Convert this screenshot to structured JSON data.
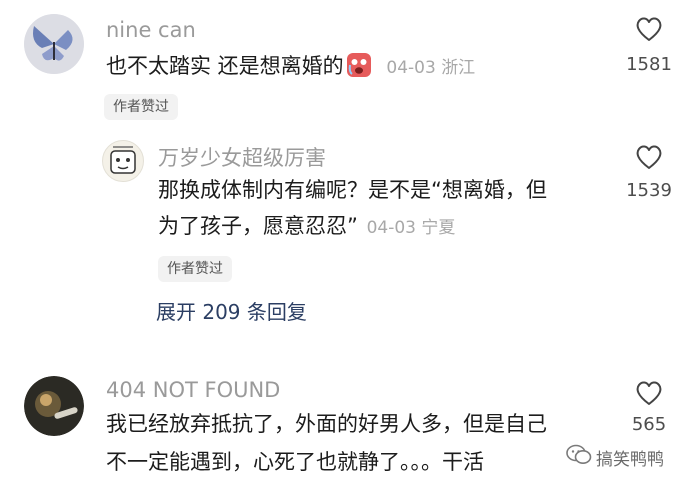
{
  "comments": [
    {
      "username": "nine can",
      "text": "也不太踏实 还是想离婚的",
      "emoji": "crying-face-emoji",
      "date": "04-03",
      "location": "浙江",
      "badge": "作者赞过",
      "likes": "1581"
    },
    {
      "username": "404 NOT FOUND",
      "text_line1": "我已经放弃抵抗了，外面的好男人多，但是自己",
      "text_line2": "不一定能遇到，心死了也就静了。。。干活",
      "likes": "565"
    }
  ],
  "reply": {
    "username": "万岁少女超级厉害",
    "text_line1": "那换成体制内有编呢？是不是“想离婚，但",
    "text_line2": "为了孩子，愿意忍忍”",
    "date": "04-03",
    "location": "宁夏",
    "badge": "作者赞过",
    "likes": "1539"
  },
  "expand_replies": "展开 209 条回复",
  "watermark": "搞笑鸭鸭",
  "colors": {
    "text": "#1c1c1c",
    "muted": "#9a9a9a",
    "link": "#2b3e63"
  }
}
